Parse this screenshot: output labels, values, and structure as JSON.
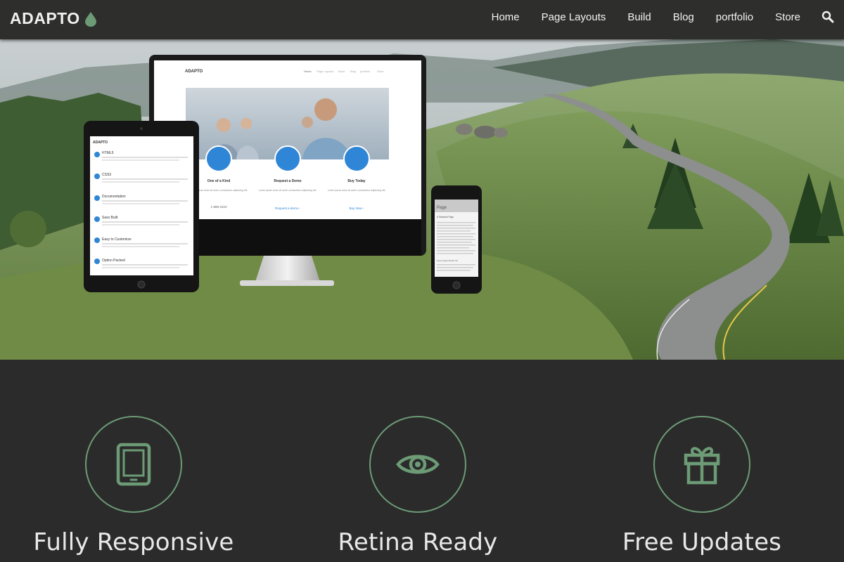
{
  "brand": {
    "name": "ADAPTO",
    "accent_color": "#6c9b76"
  },
  "nav": {
    "items": [
      {
        "label": "Home"
      },
      {
        "label": "Page Layouts"
      },
      {
        "label": "Build"
      },
      {
        "label": "Blog"
      },
      {
        "label": "portfolio"
      },
      {
        "label": "Store"
      }
    ],
    "search_icon": "search-icon"
  },
  "hero": {
    "monitor": {
      "brand": "ADAPTO",
      "nav": [
        "Home",
        "Page Layouts",
        "Build",
        "Blog",
        "portfolio",
        "Store"
      ],
      "columns": [
        {
          "title": "One of a Kind",
          "text": "Lorem ipsum dolor sit amet, consectetur adipiscing elit.",
          "link": "1-888-2323"
        },
        {
          "title": "Request a Demo",
          "text": "Lorem ipsum dolor sit amet, consectetur adipiscing elit.",
          "link": "Request a demo ›"
        },
        {
          "title": "Buy Today",
          "text": "Lorem ipsum dolor sit amet, consectetur adipiscing elit.",
          "link": "Buy Now ›"
        }
      ]
    },
    "tablet": {
      "brand": "ADAPTO",
      "items": [
        "HTML5",
        "CSS3",
        "Documentation",
        "Sass Built",
        "Easy to Customize",
        "Option Packed"
      ]
    },
    "phone": {
      "page_title": "Page",
      "subtitle": "A Standard Page",
      "footer_text": "Lorem ipsum Dolor Sit"
    }
  },
  "features": [
    {
      "title": "Fully Responsive",
      "icon": "tablet-icon"
    },
    {
      "title": "Retina Ready",
      "icon": "eye-icon"
    },
    {
      "title": "Free Updates",
      "icon": "gift-icon"
    }
  ]
}
